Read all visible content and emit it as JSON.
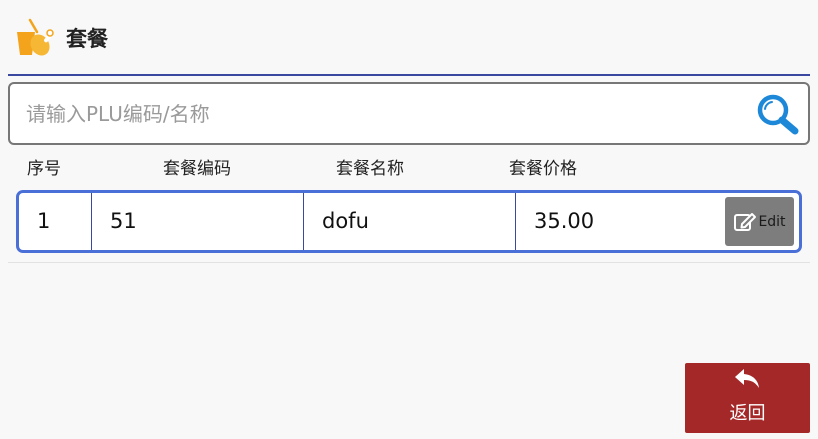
{
  "header": {
    "title": "套餐",
    "logo_icon": "drink-and-chicken-leg-icon"
  },
  "search": {
    "placeholder": "请输入PLU编码/名称",
    "value": "",
    "icon": "search-icon"
  },
  "table": {
    "columns": [
      "序号",
      "套餐编码",
      "套餐名称",
      "套餐价格"
    ],
    "rows": [
      {
        "index": "1",
        "code": "51",
        "name": "dofu",
        "price": "35.00",
        "edit_label": "Edit"
      }
    ]
  },
  "footer": {
    "back_label": "返回",
    "back_icon": "reply-arrow-icon"
  },
  "colors": {
    "accent": "#3a48a0",
    "row_border": "#4a70d8",
    "search_icon": "#1e88d8",
    "edit_button": "#7d7d7d",
    "back_button": "#a52828",
    "logo_orange": "#f4a41c"
  }
}
